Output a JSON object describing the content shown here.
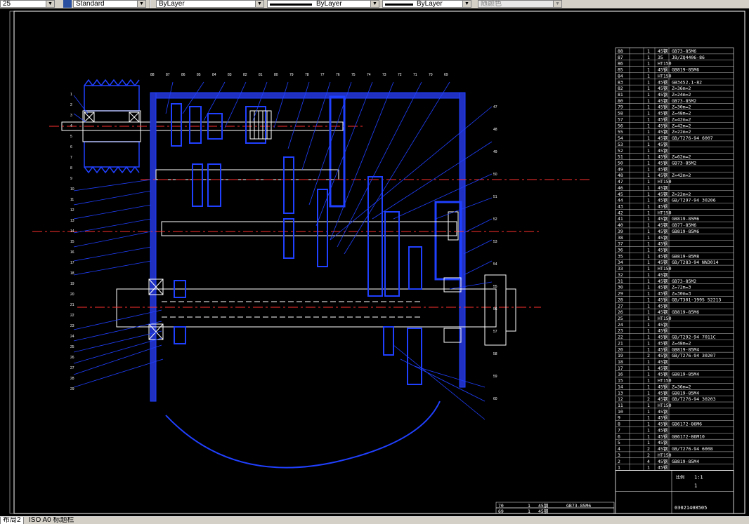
{
  "toolbar": {
    "scale_value": "25",
    "text_style": "Standard",
    "layer_color": "ByLayer",
    "linetype": "ByLayer",
    "lineweight": "ByLayer",
    "plot_style": "随颜色"
  },
  "tabs": [
    {
      "label": "布局2",
      "active": true
    },
    {
      "label": "ISO A0 标题栏",
      "active": false
    }
  ],
  "drawing": {
    "callouts_top": [
      "88",
      "87",
      "86",
      "85",
      "84",
      "83",
      "82",
      "81",
      "80",
      "79",
      "78",
      "77",
      "76",
      "75",
      "74",
      "73",
      "72",
      "71",
      "70",
      "69"
    ],
    "callouts_left": [
      "1",
      "2",
      "3",
      "4",
      "5",
      "6",
      "7",
      "8",
      "9",
      "10",
      "11",
      "12",
      "13",
      "14",
      "15",
      "16",
      "17",
      "18",
      "19",
      "20",
      "21",
      "22",
      "23",
      "24",
      "25",
      "26",
      "27",
      "28",
      "29"
    ],
    "callouts_right": [
      "47",
      "48",
      "49",
      "50",
      "51",
      "52",
      "53",
      "54",
      "55",
      "56",
      "57",
      "58",
      "59",
      "60"
    ]
  },
  "bom": {
    "rows": [
      {
        "no": "88",
        "qty": "1",
        "mat": "45钢",
        "std": "GB73-85M6"
      },
      {
        "no": "87",
        "qty": "1",
        "mat": "35",
        "std": "JB/ZQ4406-86"
      },
      {
        "no": "86",
        "qty": "1",
        "mat": "HT150",
        "std": ""
      },
      {
        "no": "85",
        "qty": "1",
        "mat": "45钢",
        "std": "GB819-85M6"
      },
      {
        "no": "84",
        "qty": "1",
        "mat": "HT150",
        "std": ""
      },
      {
        "no": "83",
        "qty": "1",
        "mat": "45钢",
        "std": "GB3452.1-82"
      },
      {
        "no": "82",
        "qty": "1",
        "mat": "45钢",
        "std": "Z=36m=2"
      },
      {
        "no": "81",
        "qty": "1",
        "mat": "45钢",
        "std": "Z=24m=2"
      },
      {
        "no": "80",
        "qty": "1",
        "mat": "45钢",
        "std": "GB73-85M2"
      },
      {
        "no": "79",
        "qty": "1",
        "mat": "45钢",
        "std": "Z=30m=2"
      },
      {
        "no": "58",
        "qty": "1",
        "mat": "45钢",
        "std": "Z=48m=2"
      },
      {
        "no": "57",
        "qty": "1",
        "mat": "45钢",
        "std": "Z=42m=2"
      },
      {
        "no": "56",
        "qty": "1",
        "mat": "45钢",
        "std": "Z=42m=2"
      },
      {
        "no": "55",
        "qty": "1",
        "mat": "45钢",
        "std": "Z=22m=2"
      },
      {
        "no": "54",
        "qty": "1",
        "mat": "45钢",
        "std": "GB/T276-94 6007"
      },
      {
        "no": "53",
        "qty": "1",
        "mat": "45钢",
        "std": ""
      },
      {
        "no": "52",
        "qty": "1",
        "mat": "45钢",
        "std": ""
      },
      {
        "no": "51",
        "qty": "1",
        "mat": "45钢",
        "std": "Z=62m=2"
      },
      {
        "no": "50",
        "qty": "1",
        "mat": "45钢",
        "std": "GB73-85M2"
      },
      {
        "no": "49",
        "qty": "1",
        "mat": "45钢",
        "std": ""
      },
      {
        "no": "48",
        "qty": "1",
        "mat": "45钢",
        "std": "Z=42m=2"
      },
      {
        "no": "47",
        "qty": "1",
        "mat": "HT150",
        "std": ""
      },
      {
        "no": "46",
        "qty": "1",
        "mat": "45钢",
        "std": ""
      },
      {
        "no": "45",
        "qty": "1",
        "mat": "45钢",
        "std": "Z=22m=2"
      },
      {
        "no": "44",
        "qty": "1",
        "mat": "45钢",
        "std": "GB/T297-94 30206"
      },
      {
        "no": "43",
        "qty": "1",
        "mat": "45钢",
        "std": ""
      },
      {
        "no": "42",
        "qty": "1",
        "mat": "HT150",
        "std": ""
      },
      {
        "no": "41",
        "qty": "1",
        "mat": "45钢",
        "std": "GB819-85M6"
      },
      {
        "no": "40",
        "qty": "1",
        "mat": "45钢",
        "std": "GB77-85M6"
      },
      {
        "no": "39",
        "qty": "1",
        "mat": "45钢",
        "std": "GB819-85M6"
      },
      {
        "no": "38",
        "qty": "1",
        "mat": "45钢",
        "std": ""
      },
      {
        "no": "37",
        "qty": "1",
        "mat": "45钢",
        "std": ""
      },
      {
        "no": "36",
        "qty": "1",
        "mat": "45钢",
        "std": ""
      },
      {
        "no": "35",
        "qty": "1",
        "mat": "45钢",
        "std": "GB819-85M8"
      },
      {
        "no": "34",
        "qty": "1",
        "mat": "45钢",
        "std": "GB/T283-94 NN3014"
      },
      {
        "no": "33",
        "qty": "1",
        "mat": "HT150",
        "std": ""
      },
      {
        "no": "32",
        "qty": "1",
        "mat": "45钢",
        "std": ""
      },
      {
        "no": "31",
        "qty": "1",
        "mat": "45钢",
        "std": "GB73-85M2"
      },
      {
        "no": "30",
        "qty": "1",
        "mat": "45钢",
        "std": "Z=72m=3"
      },
      {
        "no": "29",
        "qty": "1",
        "mat": "45钢",
        "std": "Z=30m=3"
      },
      {
        "no": "28",
        "qty": "1",
        "mat": "45钢",
        "std": "GB/T301-1995 52213"
      },
      {
        "no": "27",
        "qty": "1",
        "mat": "45钢",
        "std": ""
      },
      {
        "no": "26",
        "qty": "1",
        "mat": "45钢",
        "std": "GB819-85M6"
      },
      {
        "no": "25",
        "qty": "1",
        "mat": "HT150",
        "std": ""
      },
      {
        "no": "24",
        "qty": "1",
        "mat": "45钢",
        "std": ""
      },
      {
        "no": "23",
        "qty": "1",
        "mat": "45钢",
        "std": ""
      },
      {
        "no": "22",
        "qty": "1",
        "mat": "45钢",
        "std": "GB/T292-94 7011C"
      },
      {
        "no": "21",
        "qty": "1",
        "mat": "45钢",
        "std": "Z=48m=2"
      },
      {
        "no": "20",
        "qty": "1",
        "mat": "45钢",
        "std": "GB819-85M4"
      },
      {
        "no": "19",
        "qty": "2",
        "mat": "45钢",
        "std": "GB/T276-94 30207"
      },
      {
        "no": "18",
        "qty": "1",
        "mat": "45钢",
        "std": ""
      },
      {
        "no": "17",
        "qty": "1",
        "mat": "45钢",
        "std": ""
      },
      {
        "no": "16",
        "qty": "1",
        "mat": "45钢",
        "std": "GB819-85M4"
      },
      {
        "no": "15",
        "qty": "1",
        "mat": "HT150",
        "std": ""
      },
      {
        "no": "14",
        "qty": "1",
        "mat": "45钢",
        "std": "Z=36m=2"
      },
      {
        "no": "13",
        "qty": "1",
        "mat": "45钢",
        "std": "GB819-85M4"
      },
      {
        "no": "12",
        "qty": "2",
        "mat": "45钢",
        "std": "GB/T276-94 30203"
      },
      {
        "no": "11",
        "qty": "1",
        "mat": "HT150",
        "std": ""
      },
      {
        "no": "10",
        "qty": "1",
        "mat": "45钢",
        "std": ""
      },
      {
        "no": "9",
        "qty": "1",
        "mat": "45钢",
        "std": ""
      },
      {
        "no": "8",
        "qty": "1",
        "mat": "45钢",
        "std": "GB6172-86M6"
      },
      {
        "no": "7",
        "qty": "1",
        "mat": "45钢",
        "std": ""
      },
      {
        "no": "6",
        "qty": "1",
        "mat": "45钢",
        "std": "GB6172-86M10"
      },
      {
        "no": "5",
        "qty": "1",
        "mat": "45钢",
        "std": ""
      },
      {
        "no": "4",
        "qty": "2",
        "mat": "45钢",
        "std": "GB/T276-94 6008"
      },
      {
        "no": "3",
        "qty": "2",
        "mat": "HT150",
        "std": ""
      },
      {
        "no": "2",
        "qty": "4",
        "mat": "45钢",
        "std": "GB819-85M4"
      },
      {
        "no": "1",
        "qty": "1",
        "mat": "45钢",
        "std": ""
      }
    ],
    "title_block": {
      "scale_label": "比例",
      "scale": "1:1",
      "sheet": "1",
      "drawing_no": "03021408505"
    },
    "bottom_rows": [
      {
        "no": "70",
        "qty": "1",
        "mat": "45钢",
        "std": "GB73-85M6"
      },
      {
        "no": "69",
        "qty": "1",
        "mat": "45钢",
        "std": ""
      }
    ]
  }
}
